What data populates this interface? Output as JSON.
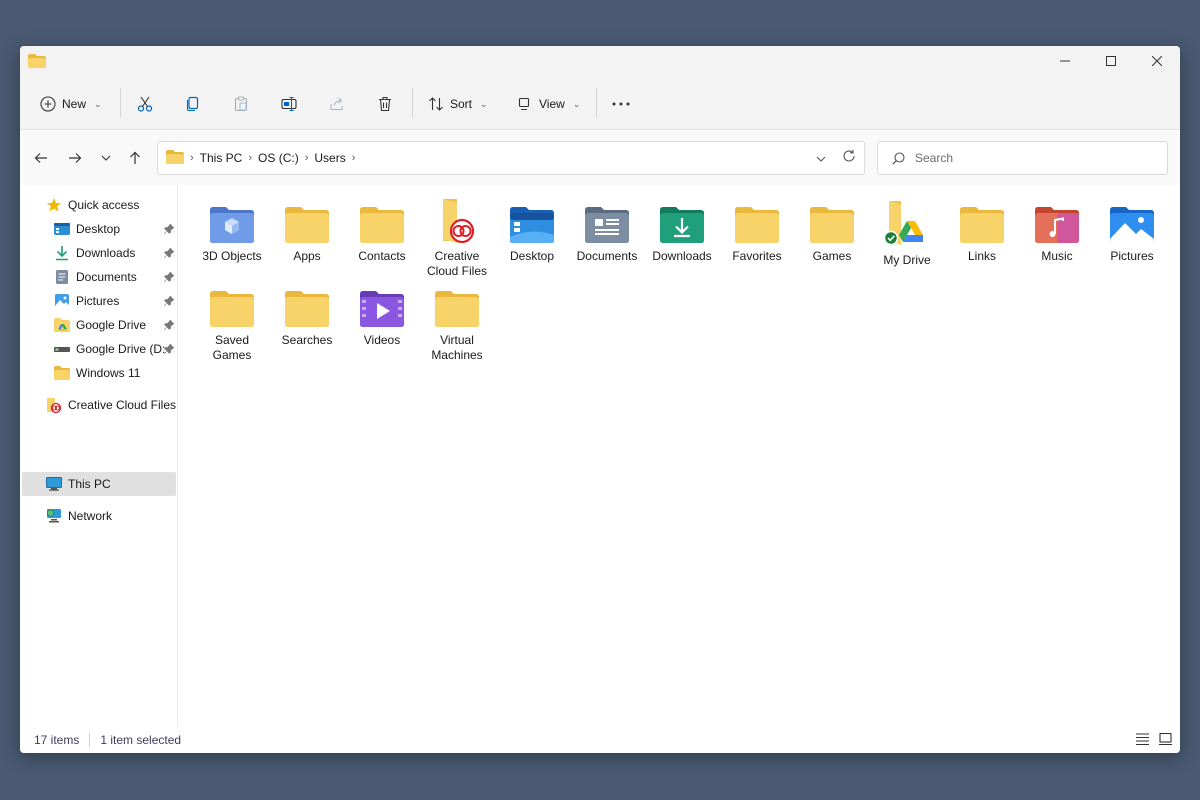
{
  "toolbar": {
    "new_label": "New",
    "sort_label": "Sort",
    "view_label": "View"
  },
  "address": {
    "crumbs": [
      "This PC",
      "OS (C:)",
      "Users"
    ]
  },
  "search": {
    "placeholder": "Search"
  },
  "sidebar": {
    "quick_access": "Quick access",
    "items": [
      {
        "label": "Desktop",
        "icon": "desktop-icon",
        "pinned": true
      },
      {
        "label": "Downloads",
        "icon": "downloads-icon",
        "pinned": true
      },
      {
        "label": "Documents",
        "icon": "documents-icon",
        "pinned": true
      },
      {
        "label": "Pictures",
        "icon": "pictures-icon",
        "pinned": true
      },
      {
        "label": "Google Drive",
        "icon": "google-drive-folder-icon",
        "pinned": true
      },
      {
        "label": "Google Drive (D:",
        "icon": "drive-icon",
        "pinned": true
      },
      {
        "label": "Windows 11",
        "icon": "folder-icon",
        "pinned": false
      }
    ],
    "creative_cloud": "Creative Cloud Files",
    "this_pc": "This PC",
    "network": "Network"
  },
  "folders": [
    {
      "label": "3D Objects",
      "icon": "3d-objects-icon"
    },
    {
      "label": "Apps",
      "icon": "folder-icon"
    },
    {
      "label": "Contacts",
      "icon": "folder-icon"
    },
    {
      "label": "Creative Cloud Files",
      "icon": "creative-cloud-icon"
    },
    {
      "label": "Desktop",
      "icon": "desktop-folder-icon"
    },
    {
      "label": "Documents",
      "icon": "documents-folder-icon"
    },
    {
      "label": "Downloads",
      "icon": "downloads-folder-icon"
    },
    {
      "label": "Favorites",
      "icon": "folder-icon"
    },
    {
      "label": "Games",
      "icon": "folder-icon"
    },
    {
      "label": "My Drive",
      "icon": "google-drive-icon"
    },
    {
      "label": "Links",
      "icon": "folder-icon"
    },
    {
      "label": "Music",
      "icon": "music-folder-icon"
    },
    {
      "label": "Pictures",
      "icon": "pictures-folder-icon"
    },
    {
      "label": "Saved Games",
      "icon": "folder-icon"
    },
    {
      "label": "Searches",
      "icon": "folder-icon"
    },
    {
      "label": "Videos",
      "icon": "videos-folder-icon"
    },
    {
      "label": "Virtual Machines",
      "icon": "folder-icon"
    }
  ],
  "status": {
    "count": "17 items",
    "selected": "1 item selected"
  },
  "colors": {
    "folder_yellow": "#f8d36a",
    "folder_back": "#e9b83c",
    "accent_blue": "#0067c0",
    "background": "#4a5a72"
  }
}
